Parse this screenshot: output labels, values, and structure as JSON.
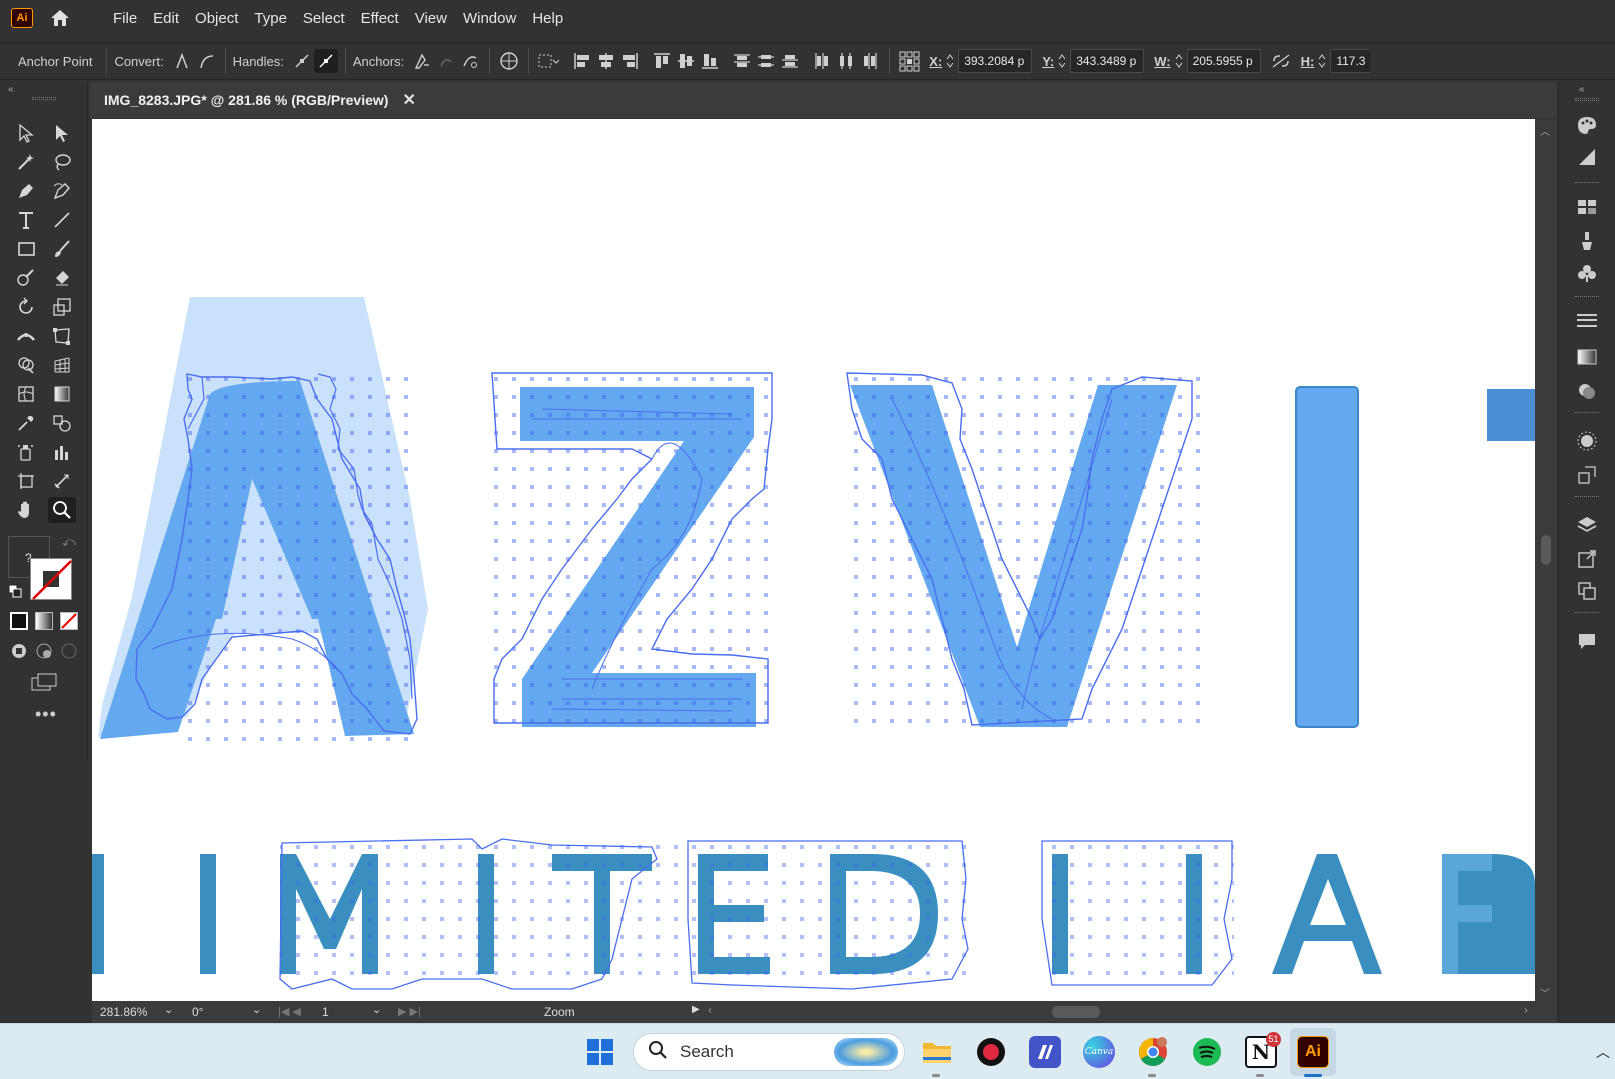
{
  "app": {
    "logo": "Ai"
  },
  "menu": [
    "File",
    "Edit",
    "Object",
    "Type",
    "Select",
    "Effect",
    "View",
    "Window",
    "Help"
  ],
  "control": {
    "anchor_point": "Anchor Point",
    "convert": "Convert:",
    "handles": "Handles:",
    "anchors": "Anchors:",
    "x_label": "X:",
    "x_value": "393.2084 p",
    "y_label": "Y:",
    "y_value": "343.3489 p",
    "w_label": "W:",
    "w_value": "205.5955 p",
    "h_label": "H:",
    "h_value": "117.3"
  },
  "document": {
    "tab_title": "IMG_8283.JPG* @ 281.86 % (RGB/Preview)",
    "close": "✕"
  },
  "artwork": {
    "top_letters": [
      "A",
      "Z",
      "V",
      "I"
    ],
    "bottom_text": "LIMITED UAE",
    "fill_color": "#64a8f0",
    "outline_color": "#4a6ef0",
    "teal_color": "#3a8fc0"
  },
  "status": {
    "zoom": "281.86%",
    "rotation": "0°",
    "artboard": "1",
    "tool": "Zoom"
  },
  "taskbar": {
    "search_placeholder": "Search",
    "notion_badge": "51",
    "apps": [
      "windows-start",
      "search",
      "file-explorer",
      "record-app",
      "linear-app",
      "canva",
      "chrome",
      "spotify",
      "notion",
      "illustrator"
    ],
    "canva_label": "Canva",
    "ai_label": "Ai"
  },
  "tool_fill_label": "?"
}
